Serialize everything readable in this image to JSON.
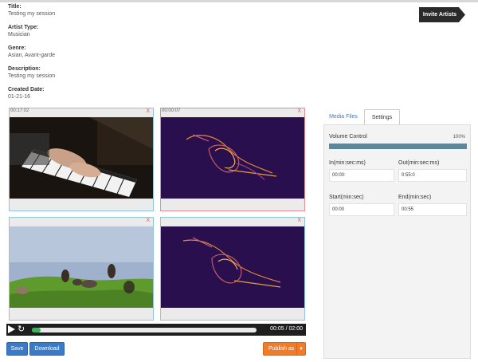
{
  "meta": {
    "title_label": "Title:",
    "title_value": "Testing my session",
    "artist_type_label": "Artist Type:",
    "artist_type_value": "Musician",
    "genre_label": "Genre:",
    "genre_value": "Asian, Avant-garde",
    "description_label": "Description:",
    "description_value": "Testing my session",
    "created_label": "Created Date:",
    "created_value": "01-21-16"
  },
  "header": {
    "invite_label": "Invite Artists"
  },
  "tiles": [
    {
      "time": "00:17:02",
      "close": "X"
    },
    {
      "time": "00:00:07",
      "close": "X"
    },
    {
      "time": "",
      "close": "X"
    },
    {
      "time": "",
      "close": "X"
    }
  ],
  "player": {
    "time": "00:05 / 02:00",
    "progress": 0.04
  },
  "buttons": {
    "save": "Save",
    "download": "Download",
    "publish": "Publish as"
  },
  "tabs": {
    "media": "Media Files",
    "settings": "Settings"
  },
  "settings": {
    "volume_label": "Volume Control",
    "volume_pct": "100%",
    "volume_level": 1.0,
    "in_label": "In(min:sec:ms)",
    "in_value": "00:00:",
    "out_label": "Out(min:sec:ms)",
    "out_value": "0:55:0",
    "start_label": "Start(min:sec)",
    "start_value": "00:00",
    "end_label": "End(min:sec)",
    "end_value": "00:55"
  },
  "colors": {
    "accent_blue": "#3a7bc8",
    "publish_orange": "#f07c2a",
    "progress_green": "#39b35a",
    "volume_bar": "#5e8799"
  }
}
